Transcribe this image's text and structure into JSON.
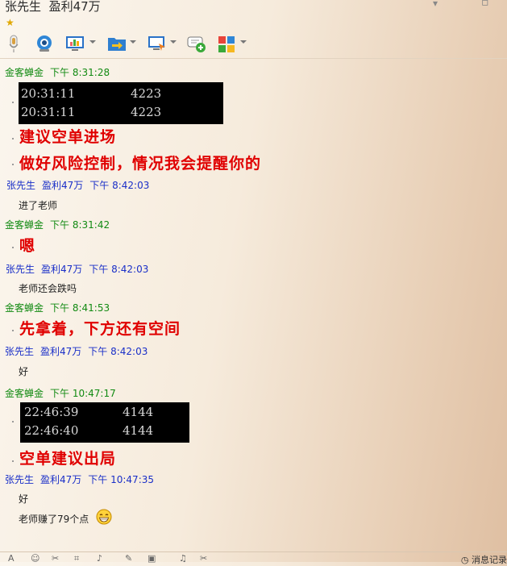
{
  "window": {
    "contact_name": "张先生",
    "contact_note": "盈利47万",
    "status_icon": "star-icon",
    "min_glyph": "▾",
    "restore_glyph": "▫"
  },
  "toolbar": {
    "items": [
      "voice-icon",
      "video-icon",
      "screen-share-icon",
      "file-transfer-icon",
      "remote-desktop-icon",
      "add-chat-icon",
      "apps-icon"
    ]
  },
  "messages": [
    {
      "sender": "金客蝉金",
      "time": "下午 8:31:28",
      "sender_color": "#128a12"
    },
    {
      "sender": "张先生",
      "note": "盈利47万",
      "time": "下午 8:42:03",
      "text": "进了老师",
      "sender_color": "#1a2fc8"
    },
    {
      "sender": "金客蝉金",
      "time": "下午 8:31:42",
      "text": "嗯"
    },
    {
      "sender": "张先生",
      "note": "盈利47万",
      "time": "下午 8:42:03",
      "text": "老师还会跌吗"
    },
    {
      "sender": "金客蝉金",
      "time": "下午 8:41:53",
      "text": "先拿着，下方还有空间"
    },
    {
      "sender": "张先生",
      "note": "盈利47万",
      "time": "下午 8:42:03",
      "text": "好"
    },
    {
      "sender": "金客蝉金",
      "time": "下午 10:47:17"
    },
    {
      "sender": "张先生",
      "note": "盈利47万",
      "time": "下午 10:47:35",
      "text": "好",
      "text2": "老师赚了79个点"
    }
  ],
  "ticker1": [
    {
      "time": "20:31:11",
      "value": "4223"
    },
    {
      "time": "20:31:11",
      "value": "4223"
    }
  ],
  "advice1": [
    "建议空单进场",
    "做好风险控制，情况我会提醒你的"
  ],
  "ticker2": [
    {
      "time": "22:46:39",
      "value": "4144"
    },
    {
      "time": "22:46:40",
      "value": "4144"
    }
  ],
  "advice2": "空单建议出局",
  "bottombar": {
    "history_label": "消息记录",
    "icons": [
      "font-icon",
      "emoji-icon",
      "cut-icon",
      "screenshot-icon",
      "mic-icon",
      "edit-icon",
      "image-icon",
      "music-icon",
      "scissors-icon"
    ]
  },
  "colors": {
    "accent_red": "#e00000",
    "green_sender": "#128a12",
    "blue_sender": "#1a2fc8"
  }
}
